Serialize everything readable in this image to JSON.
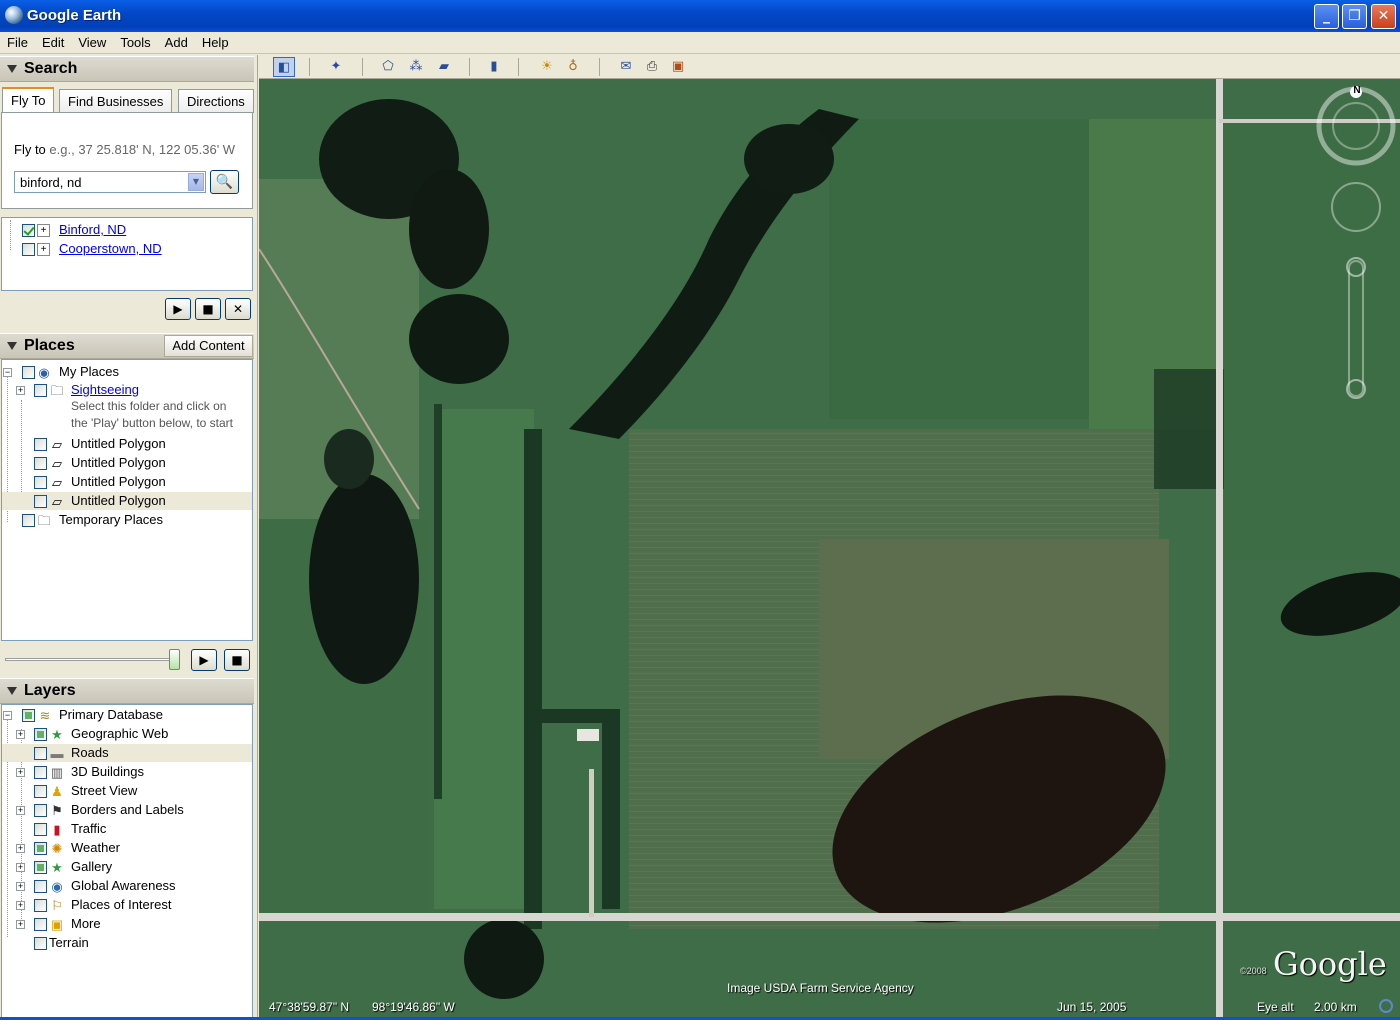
{
  "window": {
    "title": "Google Earth"
  },
  "menu": [
    "File",
    "Edit",
    "View",
    "Tools",
    "Add",
    "Help"
  ],
  "search": {
    "header": "Search",
    "tabs": [
      "Fly To",
      "Find Businesses",
      "Directions"
    ],
    "fly_label": "Fly to",
    "fly_hint": "e.g., 37 25.818' N, 122 05.36' W",
    "input_value": "binford, nd",
    "results": [
      {
        "label": "Binford, ND",
        "checked": true
      },
      {
        "label": "Cooperstown, ND",
        "checked": false
      }
    ]
  },
  "places": {
    "header": "Places",
    "add_content": "Add Content",
    "my_places": "My Places",
    "sightseeing": "Sightseeing",
    "hint_line1": "Select this folder and click on",
    "hint_line2": "the 'Play' button below, to start",
    "polygons": [
      "Untitled Polygon",
      "Untitled Polygon",
      "Untitled Polygon",
      "Untitled Polygon"
    ],
    "temporary": "Temporary Places"
  },
  "layers": {
    "header": "Layers",
    "primary": "Primary Database",
    "items": [
      {
        "label": "Geographic Web",
        "icon": "star-icon",
        "state": "part",
        "expandable": true
      },
      {
        "label": "Roads",
        "icon": "road-icon",
        "state": "off",
        "expandable": false
      },
      {
        "label": "3D Buildings",
        "icon": "building-icon",
        "state": "off",
        "expandable": true
      },
      {
        "label": "Street View",
        "icon": "person-icon",
        "state": "off",
        "expandable": false
      },
      {
        "label": "Borders and Labels",
        "icon": "flag-icon",
        "state": "off",
        "expandable": true
      },
      {
        "label": "Traffic",
        "icon": "traffic-light-icon",
        "state": "off",
        "expandable": false
      },
      {
        "label": "Weather",
        "icon": "sun-icon",
        "state": "part",
        "expandable": true
      },
      {
        "label": "Gallery",
        "icon": "star-icon",
        "state": "part",
        "expandable": true
      },
      {
        "label": "Global Awareness",
        "icon": "globe-icon",
        "state": "off",
        "expandable": true
      },
      {
        "label": "Places of Interest",
        "icon": "pin-icon",
        "state": "off",
        "expandable": true
      },
      {
        "label": "More",
        "icon": "folder-icon",
        "state": "off",
        "expandable": true
      }
    ],
    "terrain": "Terrain"
  },
  "map": {
    "credit": "Image USDA Farm Service Agency",
    "lat": "47°38'59.87\" N",
    "lon": "98°19'46.86\" W",
    "date": "Jun 15, 2005",
    "eye_label": "Eye alt",
    "eye_value": "2.00 km",
    "copyright": "©2008",
    "logo": "Google",
    "compass_n": "N"
  }
}
